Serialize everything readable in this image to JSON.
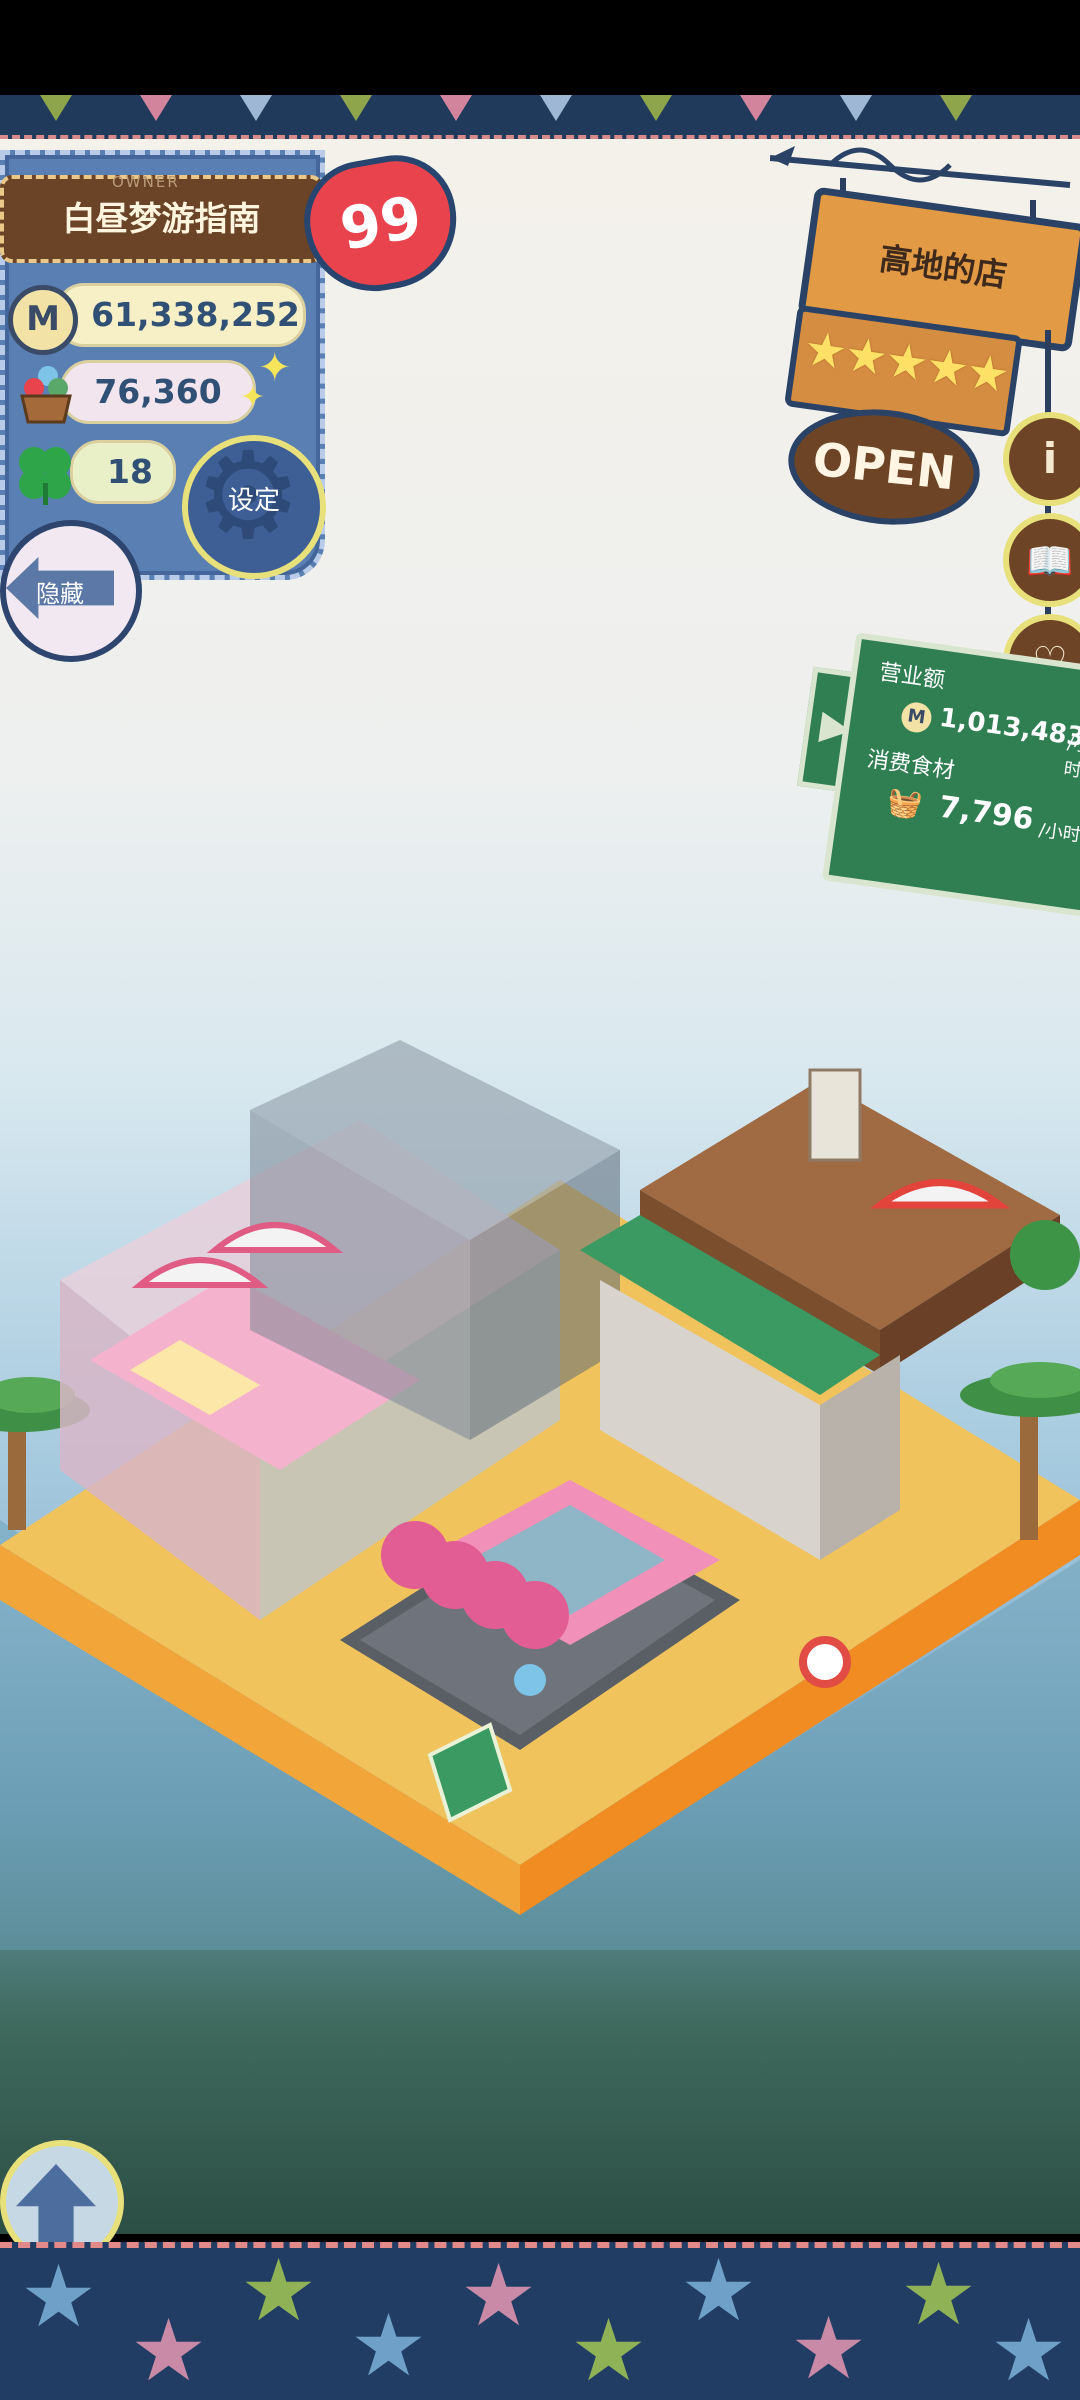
{
  "owner": {
    "label": "OWNER",
    "name": "白昼梦游指南",
    "level": "99",
    "money": "61,338,252",
    "ingredients": "76,360",
    "clovers": "18",
    "coin_glyph": "M"
  },
  "buttons": {
    "settings": "设定",
    "hide": "隐藏",
    "info": "i"
  },
  "shop": {
    "name": "高地的店",
    "status": "OPEN",
    "rating": 5
  },
  "stats": {
    "revenue_label": "营业额",
    "revenue_value": "1,013,483",
    "revenue_unit": "/小时",
    "consumption_label": "消费食材",
    "consumption_value": "7,796",
    "consumption_unit": "/小时"
  },
  "icons": {
    "coin": "coin-icon",
    "ingredients": "ingredient-basket-icon",
    "clover": "four-leaf-clover-icon",
    "sparkle": "sparkle-icon",
    "settings": "gear-icon",
    "hide": "left-arrow-icon",
    "info": "info-icon",
    "book": "book-icon",
    "heart": "heart-icon",
    "up": "up-arrow-icon"
  },
  "colors": {
    "panel_blue": "#5a7fb3",
    "wood_brown": "#6d4526",
    "sign_orange": "#e39a45",
    "board_green": "#2f7f53",
    "heart_red": "#e9444d",
    "sand": "#f2c25c",
    "sea": "#a9cce0"
  }
}
